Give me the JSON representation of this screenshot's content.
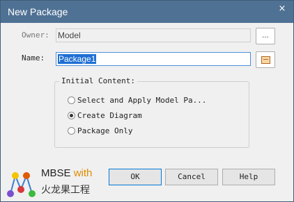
{
  "window": {
    "title": "New Package",
    "close_label": "×"
  },
  "form": {
    "owner_label": "Owner:",
    "owner_value": "Model",
    "browse_label": "...",
    "name_label": "Name:",
    "name_value": "Package1"
  },
  "initial_content": {
    "group_label": "Initial Content:",
    "options": [
      {
        "label": "Select and Apply Model Pa...",
        "checked": false
      },
      {
        "label": "Create Diagram",
        "checked": true
      },
      {
        "label": "Package Only",
        "checked": false
      }
    ]
  },
  "branding": {
    "line1_main": "MBSE ",
    "line1_accent": "with",
    "line2": "火龙果工程",
    "accent_color": "#e08a00"
  },
  "buttons": {
    "ok": "OK",
    "cancel": "Cancel",
    "help": "Help"
  },
  "colors": {
    "titlebar": "#4f7194",
    "selection": "#1e6fd3"
  }
}
